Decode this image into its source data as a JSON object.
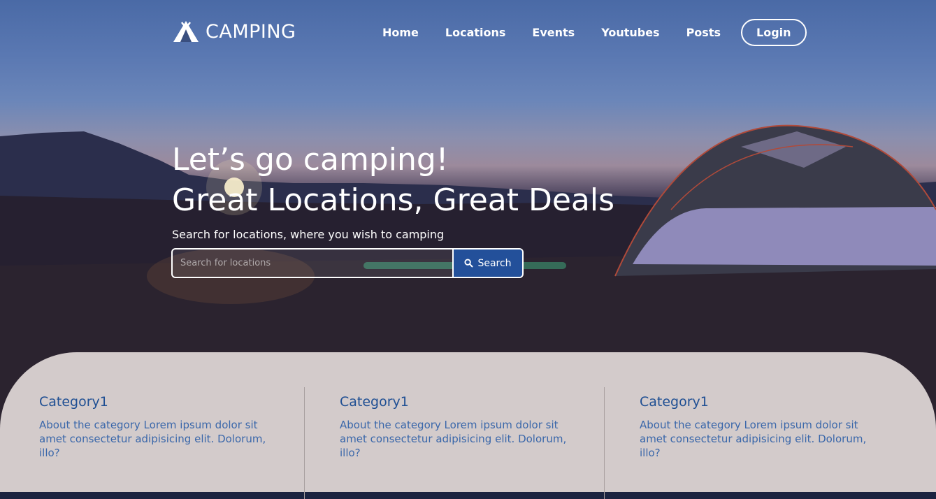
{
  "brand": {
    "name": "CAMPING",
    "icon": "tent-icon"
  },
  "nav": {
    "items": [
      {
        "label": "Home"
      },
      {
        "label": "Locations"
      },
      {
        "label": "Events"
      },
      {
        "label": "Youtubes"
      },
      {
        "label": "Posts"
      }
    ],
    "login_label": "Login"
  },
  "hero": {
    "line1": "Let’s go camping!",
    "line2": "Great Locations, Great Deals",
    "subtitle": "Search for locations, where you wish to camping",
    "search_placeholder": "Search for locations",
    "search_button": "Search",
    "search_icon": "search-icon"
  },
  "categories": [
    {
      "title": "Category1",
      "text": "About the category Lorem ipsum dolor sit amet consectetur adipisicing elit. Dolorum, illo?"
    },
    {
      "title": "Category1",
      "text": "About the category Lorem ipsum dolor sit amet consectetur adipisicing elit. Dolorum, illo?"
    },
    {
      "title": "Category1",
      "text": "About the category Lorem ipsum dolor sit amet consectetur adipisicing elit. Dolorum, illo?"
    }
  ],
  "colors": {
    "accent": "#23509a",
    "panel": "#d3cbcb",
    "category_text": "#2a5aa0"
  }
}
